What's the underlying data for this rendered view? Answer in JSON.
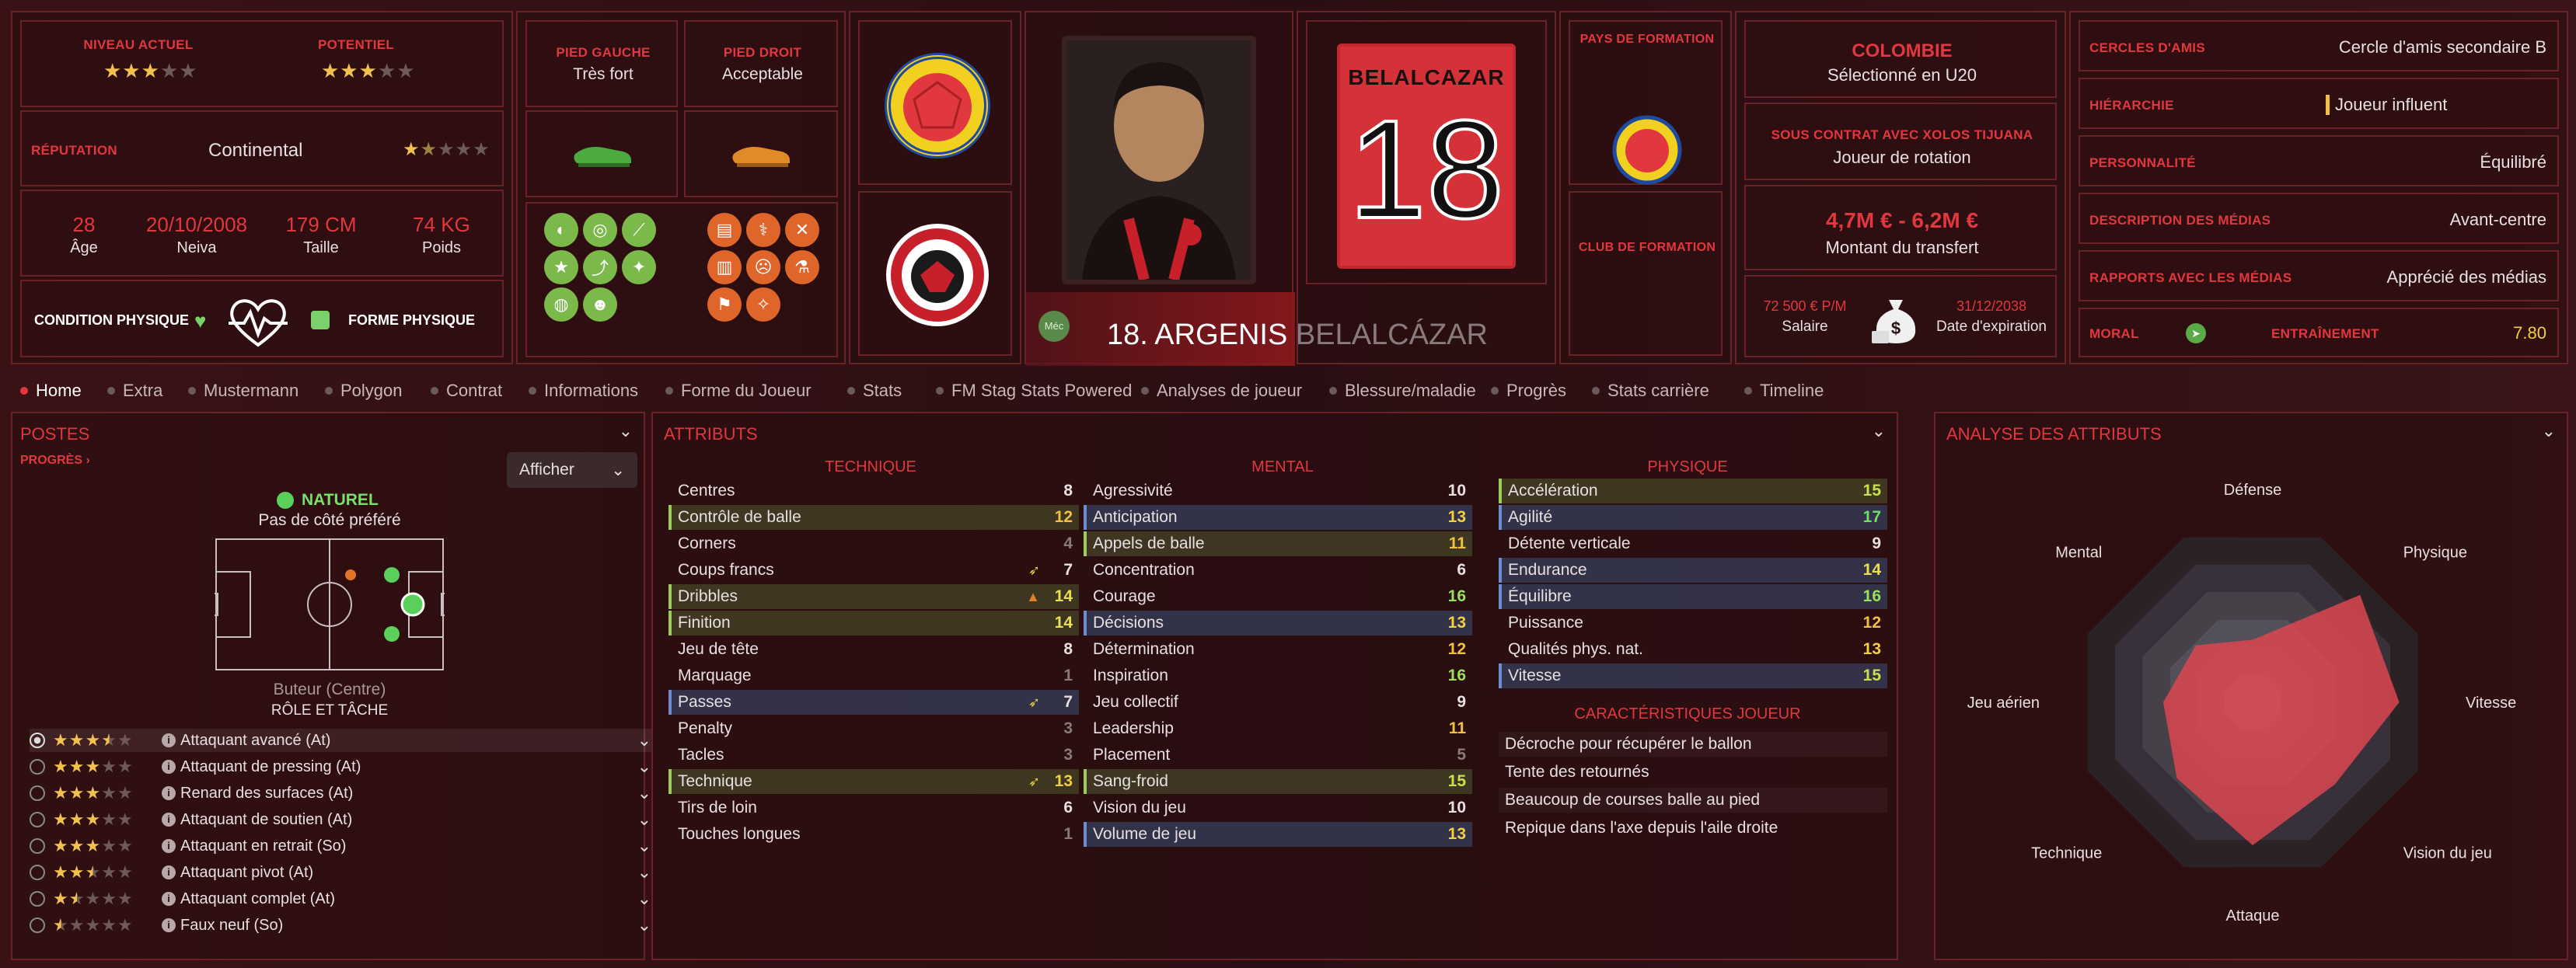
{
  "profile": {
    "niveau_label": "NIVEAU ACTUEL",
    "niveau_stars": 3,
    "potentiel_label": "POTENTIEL",
    "potentiel_stars": 3,
    "reputation_label": "RÉPUTATION",
    "reputation_value": "Continental",
    "age_value": "28",
    "age_label": "Âge",
    "birth_value": "20/10/2008",
    "birth_label": "Neiva",
    "height_value": "179 CM",
    "height_label": "Taille",
    "weight_value": "74 KG",
    "weight_label": "Poids",
    "condition_label": "CONDITION PHYSIQUE",
    "forme_label": "FORME PHYSIQUE"
  },
  "feet": {
    "left_label": "PIED GAUCHE",
    "left_value": "Très fort",
    "right_label": "PIED DROIT",
    "right_value": "Acceptable"
  },
  "player": {
    "shirt_name": "BELALCAZAR",
    "shirt_number": "18",
    "full_name": "18. ARGENIS BELALCÁZAR",
    "tag": "Méc"
  },
  "formation": {
    "country_label": "PAYS DE FORMATION",
    "club_label": "CLUB DE FORMATION"
  },
  "contract": {
    "country": "COLOMBIE",
    "selection": "Sélectionné en U20",
    "contract_label": "SOUS CONTRAT AVEC XOLOS TIJUANA",
    "role": "Joueur de rotation",
    "transfer_value": "4,7M € - 6,2M €",
    "transfer_label": "Montant du transfert",
    "salary_value": "72 500 € P/M",
    "salary_label": "Salaire",
    "expiry_value": "31/12/2038",
    "expiry_label": "Date d'expiration"
  },
  "social": [
    {
      "label": "CERCLES D'AMIS",
      "value": "Cercle d'amis secondaire B"
    },
    {
      "label": "HIÉRARCHIE",
      "value": "Joueur influent"
    },
    {
      "label": "PERSONNALITÉ",
      "value": "Équilibré"
    },
    {
      "label": "DESCRIPTION DES MÉDIAS",
      "value": "Avant-centre"
    },
    {
      "label": "RAPPORTS AVEC LES MÉDIAS",
      "value": "Apprécié des médias"
    }
  ],
  "moral": {
    "label": "MORAL",
    "training_label": "ENTRAÎNEMENT",
    "training_value": "7.80"
  },
  "tabs": [
    "Home",
    "Extra",
    "Mustermann",
    "Polygon",
    "Contrat",
    "Informations",
    "Forme du Joueur",
    "Stats",
    "FM Stag Stats Powered",
    "Analyses de joueur",
    "Blessure/maladie",
    "Progrès",
    "Stats carrière",
    "Timeline"
  ],
  "postes": {
    "title": "POSTES",
    "progress_link": "PROGRÈS",
    "show_button": "Afficher",
    "natural_label": "NATUREL",
    "side_label": "Pas de côté préféré",
    "position_label": "Buteur (Centre)",
    "role_label": "RÔLE ET TÂCHE",
    "roles": [
      {
        "name": "Attaquant avancé (At)",
        "stars": 3.5
      },
      {
        "name": "Attaquant de pressing (At)",
        "stars": 3
      },
      {
        "name": "Renard des surfaces (At)",
        "stars": 3
      },
      {
        "name": "Attaquant de soutien (At)",
        "stars": 3
      },
      {
        "name": "Attaquant en retrait (So)",
        "stars": 3
      },
      {
        "name": "Attaquant pivot (At)",
        "stars": 2.5
      },
      {
        "name": "Attaquant complet (At)",
        "stars": 1.5
      },
      {
        "name": "Faux neuf (So)",
        "stars": 0.5
      }
    ]
  },
  "attributes": {
    "title": "ATTRIBUTS",
    "technique_label": "TECHNIQUE",
    "mental_label": "MENTAL",
    "physique_label": "PHYSIQUE",
    "technique": [
      {
        "name": "Centres",
        "value": "8",
        "hl": ""
      },
      {
        "name": "Contrôle de balle",
        "value": "12",
        "hl": "g"
      },
      {
        "name": "Corners",
        "value": "4",
        "hl": ""
      },
      {
        "name": "Coups francs",
        "value": "7",
        "hl": "",
        "arrow": "up"
      },
      {
        "name": "Dribbles",
        "value": "14",
        "hl": "g",
        "arrow": "down"
      },
      {
        "name": "Finition",
        "value": "14",
        "hl": "g"
      },
      {
        "name": "Jeu de tête",
        "value": "8",
        "hl": ""
      },
      {
        "name": "Marquage",
        "value": "1",
        "hl": ""
      },
      {
        "name": "Passes",
        "value": "7",
        "hl": "b",
        "arrow": "up"
      },
      {
        "name": "Penalty",
        "value": "3",
        "hl": ""
      },
      {
        "name": "Tacles",
        "value": "3",
        "hl": ""
      },
      {
        "name": "Technique",
        "value": "13",
        "hl": "g",
        "arrow": "up"
      },
      {
        "name": "Tirs de loin",
        "value": "6",
        "hl": ""
      },
      {
        "name": "Touches longues",
        "value": "1",
        "hl": ""
      }
    ],
    "mental": [
      {
        "name": "Agressivité",
        "value": "10",
        "hl": ""
      },
      {
        "name": "Anticipation",
        "value": "13",
        "hl": "b"
      },
      {
        "name": "Appels de balle",
        "value": "11",
        "hl": "g"
      },
      {
        "name": "Concentration",
        "value": "6",
        "hl": ""
      },
      {
        "name": "Courage",
        "value": "16",
        "hl": ""
      },
      {
        "name": "Décisions",
        "value": "13",
        "hl": "b"
      },
      {
        "name": "Détermination",
        "value": "12",
        "hl": ""
      },
      {
        "name": "Inspiration",
        "value": "16",
        "hl": ""
      },
      {
        "name": "Jeu collectif",
        "value": "9",
        "hl": ""
      },
      {
        "name": "Leadership",
        "value": "11",
        "hl": ""
      },
      {
        "name": "Placement",
        "value": "5",
        "hl": ""
      },
      {
        "name": "Sang-froid",
        "value": "15",
        "hl": "g"
      },
      {
        "name": "Vision du jeu",
        "value": "10",
        "hl": ""
      },
      {
        "name": "Volume de jeu",
        "value": "13",
        "hl": "b"
      }
    ],
    "physique": [
      {
        "name": "Accélération",
        "value": "15",
        "hl": "g"
      },
      {
        "name": "Agilité",
        "value": "17",
        "hl": "b"
      },
      {
        "name": "Détente verticale",
        "value": "9",
        "hl": ""
      },
      {
        "name": "Endurance",
        "value": "14",
        "hl": "b"
      },
      {
        "name": "Équilibre",
        "value": "16",
        "hl": "b"
      },
      {
        "name": "Puissance",
        "value": "12",
        "hl": ""
      },
      {
        "name": "Qualités phys. nat.",
        "value": "13",
        "hl": ""
      },
      {
        "name": "Vitesse",
        "value": "15",
        "hl": "b"
      }
    ],
    "traits_label": "CARACTÉRISTIQUES JOUEUR",
    "traits": [
      "Décroche pour récupérer le ballon",
      "Tente des retournés",
      "Beaucoup de courses balle au pied",
      "Repique dans l'axe depuis l'aile droite"
    ]
  },
  "radar": {
    "title": "ANALYSE DES ATTRIBUTS",
    "axes": [
      "Défense",
      "Physique",
      "Vitesse",
      "Vision du jeu",
      "Attaque",
      "Technique",
      "Jeu aérien",
      "Mental"
    ],
    "values": [
      0.35,
      0.85,
      0.82,
      0.65,
      0.8,
      0.6,
      0.5,
      0.45
    ]
  },
  "colors": {
    "accent": "#e0383e",
    "panel_border": "#6a2227",
    "star": "#f2c14e",
    "green": "#7ab94a",
    "orange": "#e0652a"
  }
}
